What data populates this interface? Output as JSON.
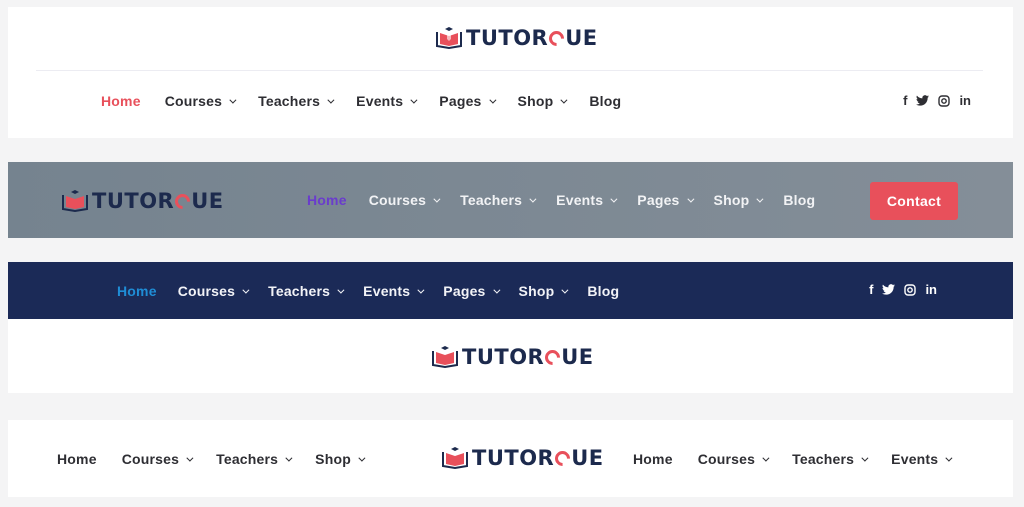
{
  "brand": {
    "name_prefix": "TUTOR",
    "name_suffix": "UE",
    "colors": {
      "primary": "#e8505b",
      "navy": "#1c2a4d",
      "dark_bar": "#1b2a57",
      "grey_bar": "#7b8893",
      "purple_active": "#6a3ccc",
      "blue_active": "#1f8dd6"
    }
  },
  "header1": {
    "nav": [
      {
        "label": "Home",
        "active": true,
        "dropdown": false
      },
      {
        "label": "Courses",
        "dropdown": true
      },
      {
        "label": "Teachers",
        "dropdown": true
      },
      {
        "label": "Events",
        "dropdown": true
      },
      {
        "label": "Pages",
        "dropdown": true
      },
      {
        "label": "Shop",
        "dropdown": true
      },
      {
        "label": "Blog",
        "dropdown": false
      }
    ],
    "social": [
      {
        "icon": "facebook-icon",
        "glyph": "f"
      },
      {
        "icon": "twitter-icon",
        "glyph": "🐦"
      },
      {
        "icon": "instagram-icon",
        "glyph": "◎"
      },
      {
        "icon": "linkedin-icon",
        "glyph": "in"
      }
    ]
  },
  "header2": {
    "nav": [
      {
        "label": "Home",
        "active": true
      },
      {
        "label": "Courses"
      },
      {
        "label": "Teachers"
      },
      {
        "label": "Events"
      },
      {
        "label": "Pages"
      },
      {
        "label": "Shop"
      },
      {
        "label": "Blog"
      }
    ],
    "contact_label": "Contact"
  },
  "header3": {
    "nav": [
      {
        "label": "Home",
        "active": true
      },
      {
        "label": "Courses"
      },
      {
        "label": "Teachers"
      },
      {
        "label": "Events"
      },
      {
        "label": "Pages"
      },
      {
        "label": "Shop"
      },
      {
        "label": "Blog"
      }
    ]
  },
  "header4": {
    "nav_left": [
      {
        "label": "Home"
      },
      {
        "label": "Courses"
      },
      {
        "label": "Teachers"
      },
      {
        "label": "Shop"
      }
    ],
    "nav_right": [
      {
        "label": "Home"
      },
      {
        "label": "Courses"
      },
      {
        "label": "Teachers"
      },
      {
        "label": "Events"
      }
    ]
  }
}
